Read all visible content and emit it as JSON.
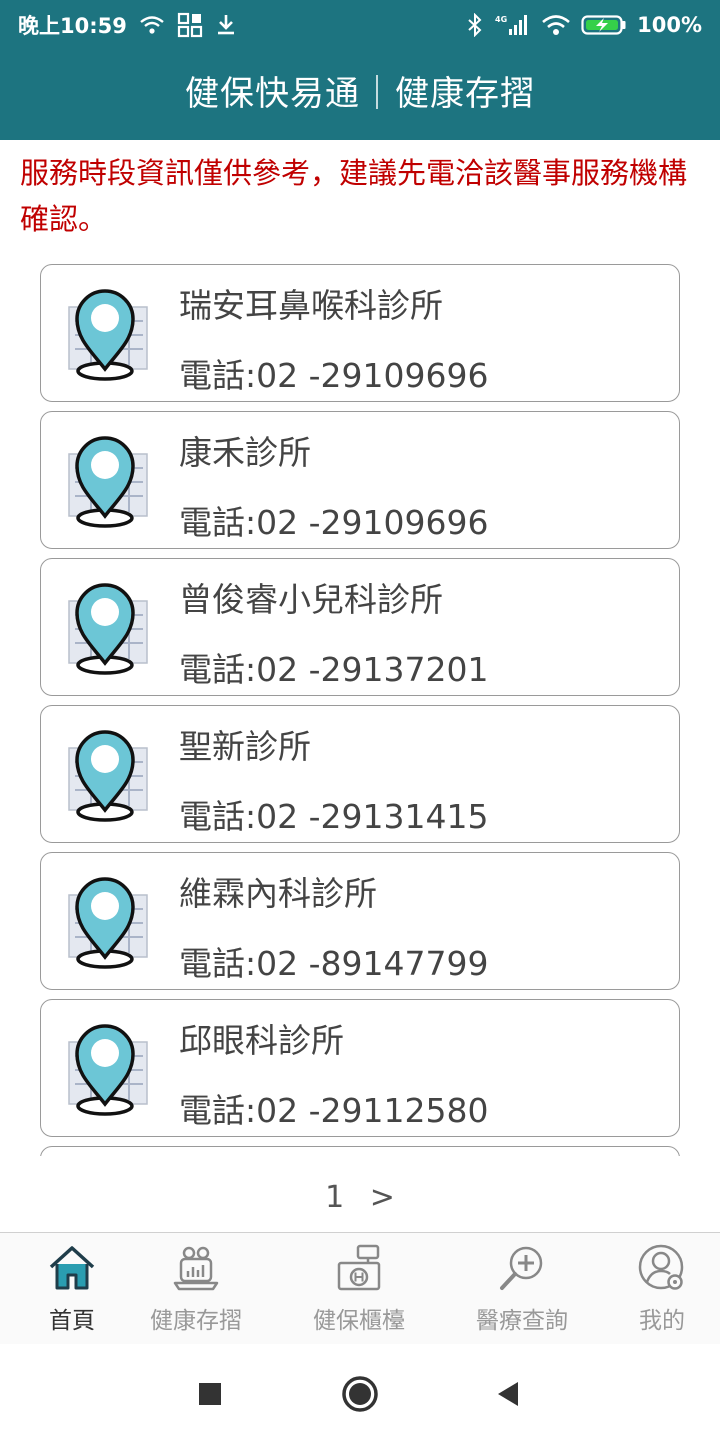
{
  "status_bar": {
    "time": "晚上10:59",
    "network": "4G",
    "battery": "100%"
  },
  "header": {
    "title": "健保快易通｜健康存摺"
  },
  "notice": "服務時段資訊僅供參考，建議先電洽該醫事服務機構確認。",
  "clinics": [
    {
      "name": "瑞安耳鼻喉科診所",
      "phone": "電話:02 -29109696"
    },
    {
      "name": "康禾診所",
      "phone": "電話:02 -29109696"
    },
    {
      "name": "曾俊睿小兒科診所",
      "phone": "電話:02 -29137201"
    },
    {
      "name": "聖新診所",
      "phone": "電話:02 -29131415"
    },
    {
      "name": "維霖內科診所",
      "phone": "電話:02 -89147799"
    },
    {
      "name": "邱眼科診所",
      "phone": "電話:02 -29112580"
    }
  ],
  "pagination": {
    "current": "1",
    "next": ">"
  },
  "tabs": [
    {
      "label": "首頁",
      "icon": "home-icon",
      "active": true
    },
    {
      "label": "健康存摺",
      "icon": "health-record-icon",
      "active": false
    },
    {
      "label": "健保櫃檯",
      "icon": "counter-icon",
      "active": false
    },
    {
      "label": "醫療查詢",
      "icon": "medical-search-icon",
      "active": false
    },
    {
      "label": "我的",
      "icon": "profile-icon",
      "active": false
    }
  ],
  "colors": {
    "header_bg": "#1d7480",
    "notice_text": "#c00000",
    "pin_fill": "#6cc6d6",
    "active_tab_icon": "#2a9db0"
  }
}
